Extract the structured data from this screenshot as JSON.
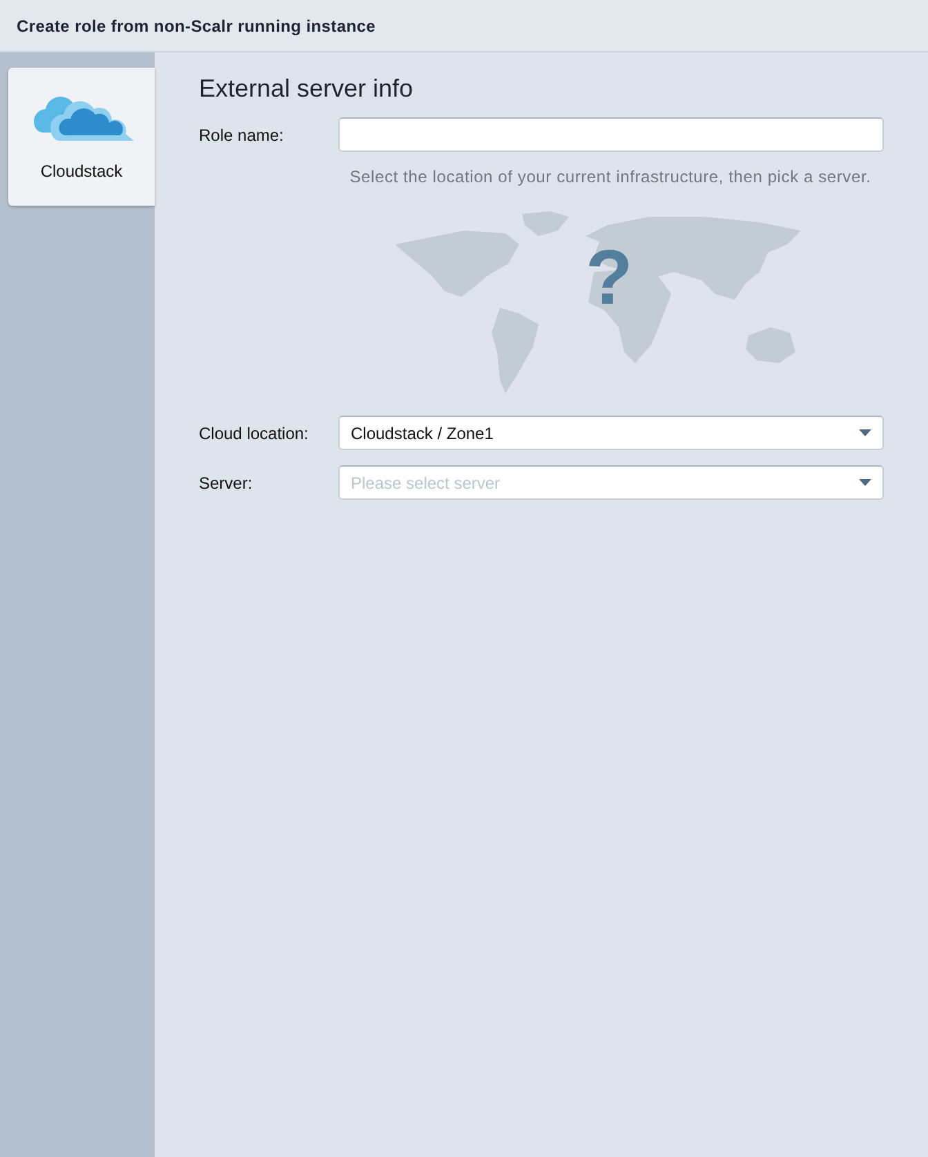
{
  "window": {
    "title": "Create role from non-Scalr running instance"
  },
  "sidebar": {
    "items": [
      {
        "label": "Cloudstack",
        "selected": true
      }
    ]
  },
  "form": {
    "title": "External server info",
    "role_name": {
      "label": "Role name:"
    },
    "hint": "Select the location of your current infrastructure, then pick a server.",
    "map": {
      "mark": "?"
    },
    "fields": [
      {
        "label": "Cloud location:",
        "value": "Cloudstack / Zone1"
      },
      {
        "label": "Server:",
        "placeholder": "Please select server"
      }
    ]
  }
}
